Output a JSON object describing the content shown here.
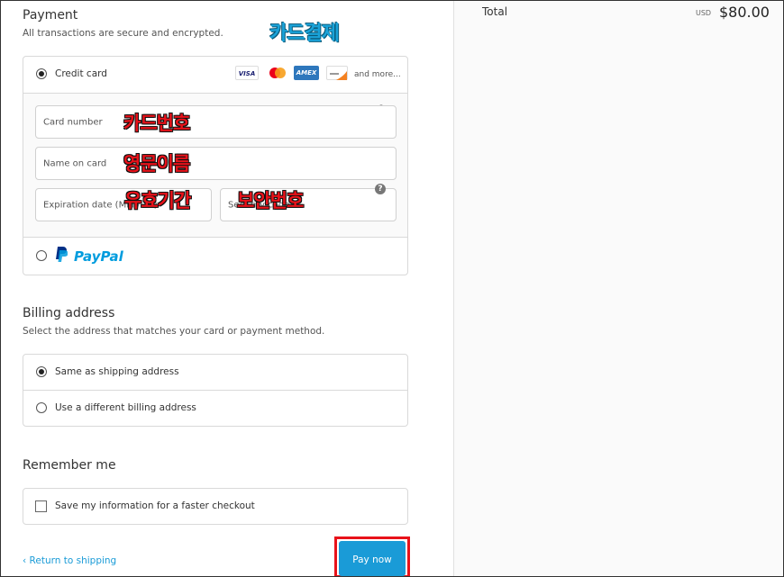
{
  "payment": {
    "title": "Payment",
    "subtitle": "All transactions are secure and encrypted.",
    "korean_heading": "카드결제",
    "credit_card_label": "Credit card",
    "card_brands": [
      "VISA",
      "",
      "AMEX",
      ""
    ],
    "and_more": "and more...",
    "fields": {
      "card_number": "Card number",
      "name_on_card": "Name on card",
      "expiration": "Expiration date (MM / YY)",
      "security_code": "Security code"
    },
    "korean_labels": {
      "card_number": "카드번호",
      "name": "영문이름",
      "expiry": "유효기간",
      "security": "보안번호"
    },
    "paypal_label": "PayPal"
  },
  "billing": {
    "title": "Billing address",
    "subtitle": "Select the address that matches your card or payment method.",
    "options": [
      "Same as shipping address",
      "Use a different billing address"
    ]
  },
  "remember": {
    "title": "Remember me",
    "checkbox_label": "Save my information for a faster checkout"
  },
  "footer": {
    "return_label": "Return to shipping",
    "pay_label": "Pay now"
  },
  "summary": {
    "total_label": "Total",
    "currency": "USD",
    "total_value": "$80.00"
  },
  "colors": {
    "accent": "#1a9bd7",
    "highlight": "#e8121a",
    "korean_heading": "#1aa3d9"
  }
}
